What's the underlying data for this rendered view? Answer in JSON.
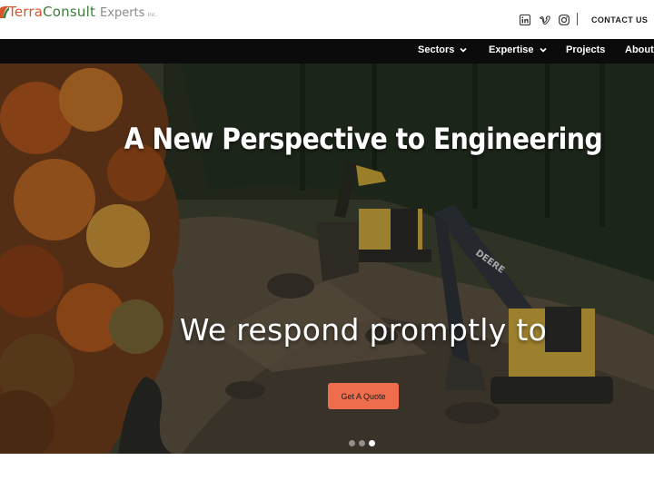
{
  "header": {
    "logo": {
      "terra": "Terra",
      "consult": "Consult",
      "experts": "Experts",
      "inc": "Inc."
    },
    "social": [
      {
        "name": "linkedin-icon",
        "glyph": "in"
      },
      {
        "name": "vimeo-icon",
        "glyph": "v"
      },
      {
        "name": "instagram-icon",
        "glyph": "ig"
      }
    ],
    "contact_label": "CONTACT US"
  },
  "nav": {
    "sectors": "Sectors",
    "expertise": "Expertise",
    "projects": "Projects",
    "about": "About"
  },
  "hero": {
    "title": "A New Perspective to Engineering",
    "subtitle": "We respond promptly to",
    "cta_label": "Get A Quote",
    "excavator_brand": "DEERE",
    "slides_total": 3,
    "active_slide": 3
  },
  "colors": {
    "terra": "#d4572a",
    "consult": "#3b7d3b",
    "navbar": "#0b0b0b",
    "cta": "#ee6d4c"
  }
}
